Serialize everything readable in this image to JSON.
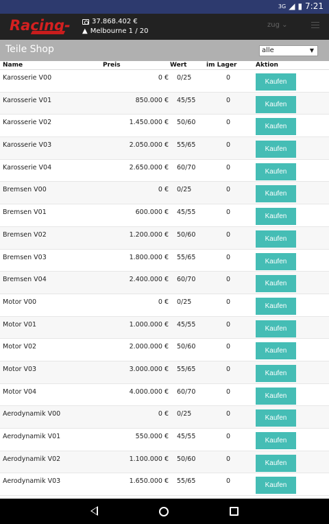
{
  "status": {
    "time": "7:21",
    "network": "3G"
  },
  "app": {
    "logo_part1": "Racing-",
    "money": "37.868.402 €",
    "location": "Melbourne 1 / 20",
    "zug_label": "zug"
  },
  "page": {
    "title": "Teile Shop",
    "filter_value": "alle"
  },
  "table": {
    "headers": {
      "name": "Name",
      "preis": "Preis",
      "wert": "Wert",
      "lager": "im Lager",
      "aktion": "Aktion"
    },
    "button_label": "Kaufen",
    "rows": [
      {
        "name": "Karosserie V00",
        "preis": "0 €",
        "wert": "0/25",
        "lager": "0"
      },
      {
        "name": "Karosserie V01",
        "preis": "850.000 €",
        "wert": "45/55",
        "lager": "0"
      },
      {
        "name": "Karosserie V02",
        "preis": "1.450.000 €",
        "wert": "50/60",
        "lager": "0"
      },
      {
        "name": "Karosserie V03",
        "preis": "2.050.000 €",
        "wert": "55/65",
        "lager": "0"
      },
      {
        "name": "Karosserie V04",
        "preis": "2.650.000 €",
        "wert": "60/70",
        "lager": "0"
      },
      {
        "name": "Bremsen V00",
        "preis": "0 €",
        "wert": "0/25",
        "lager": "0"
      },
      {
        "name": "Bremsen V01",
        "preis": "600.000 €",
        "wert": "45/55",
        "lager": "0"
      },
      {
        "name": "Bremsen V02",
        "preis": "1.200.000 €",
        "wert": "50/60",
        "lager": "0"
      },
      {
        "name": "Bremsen V03",
        "preis": "1.800.000 €",
        "wert": "55/65",
        "lager": "0"
      },
      {
        "name": "Bremsen V04",
        "preis": "2.400.000 €",
        "wert": "60/70",
        "lager": "0"
      },
      {
        "name": "Motor V00",
        "preis": "0 €",
        "wert": "0/25",
        "lager": "0"
      },
      {
        "name": "Motor V01",
        "preis": "1.000.000 €",
        "wert": "45/55",
        "lager": "0"
      },
      {
        "name": "Motor V02",
        "preis": "2.000.000 €",
        "wert": "50/60",
        "lager": "0"
      },
      {
        "name": "Motor V03",
        "preis": "3.000.000 €",
        "wert": "55/65",
        "lager": "0"
      },
      {
        "name": "Motor V04",
        "preis": "4.000.000 €",
        "wert": "60/70",
        "lager": "0"
      },
      {
        "name": "Aerodynamik V00",
        "preis": "0 €",
        "wert": "0/25",
        "lager": "0"
      },
      {
        "name": "Aerodynamik V01",
        "preis": "550.000 €",
        "wert": "45/55",
        "lager": "0"
      },
      {
        "name": "Aerodynamik V02",
        "preis": "1.100.000 €",
        "wert": "50/60",
        "lager": "0"
      },
      {
        "name": "Aerodynamik V03",
        "preis": "1.650.000 €",
        "wert": "55/65",
        "lager": "0"
      }
    ]
  },
  "colors": {
    "status_bar": "#2d3a6e",
    "app_bar": "#222222",
    "title_bar": "#b0b0b0",
    "button": "#45bdb5",
    "logo_red": "#d42020"
  }
}
